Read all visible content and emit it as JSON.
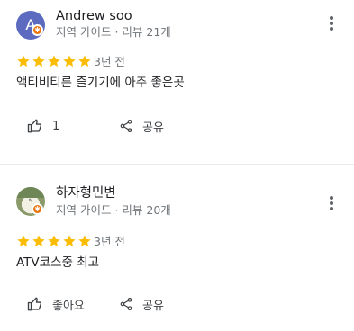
{
  "reviews": [
    {
      "avatar_letter": "A",
      "avatar_color": "#5c6bc0",
      "name": "Andrew soo",
      "meta": "지역 가이드 · 리뷰 21개",
      "rating": 5,
      "time": "3년 전",
      "text": "액티비티른 즐기기에 아주 좋은곳",
      "like_label": "1",
      "share_label": "공유"
    },
    {
      "avatar_image": "profile-photo",
      "name": "하자형민변",
      "meta": "지역 가이드 · 리뷰 20개",
      "rating": 5,
      "time": "3년 전",
      "text": "ATV코스중 최고",
      "like_label": "좋아요",
      "share_label": "공유"
    }
  ],
  "colors": {
    "star": "#fbbc04",
    "badge": "#e8710a",
    "secondary_text": "#70757a",
    "divider": "#e8eaed"
  },
  "icons": {
    "local_guide_badge": "star-badge-icon",
    "more": "more-vert-icon",
    "like": "thumb-up-icon",
    "share": "share-icon",
    "rating": "star-icon"
  }
}
